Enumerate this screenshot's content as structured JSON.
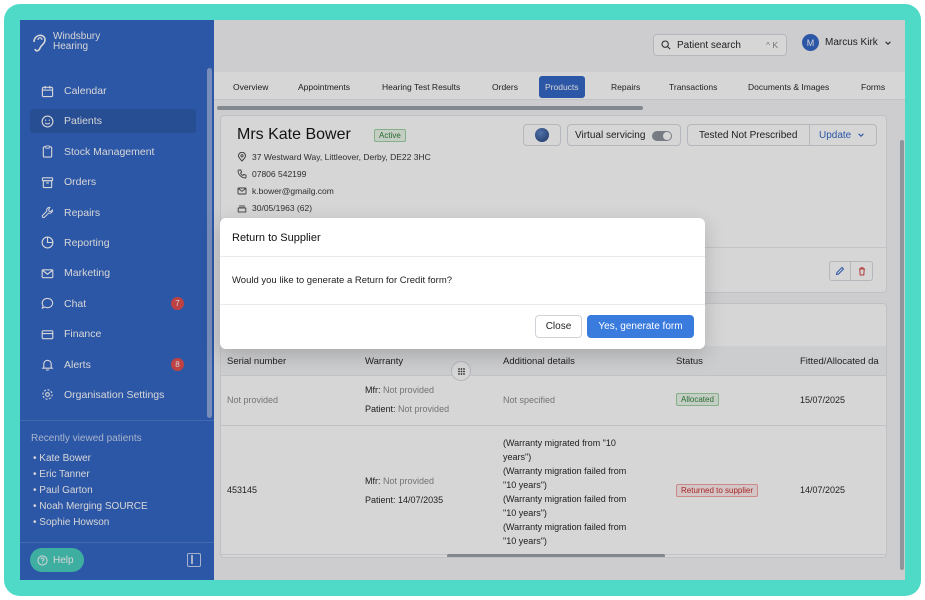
{
  "brand": {
    "line1": "Windsbury",
    "line2": "Hearing"
  },
  "sidebar": {
    "items": [
      {
        "label": "Calendar",
        "icon": "calendar-icon"
      },
      {
        "label": "Patients",
        "icon": "smile-icon",
        "active": true
      },
      {
        "label": "Stock Management",
        "icon": "clipboard-icon"
      },
      {
        "label": "Orders",
        "icon": "box-icon"
      },
      {
        "label": "Repairs",
        "icon": "wrench-icon"
      },
      {
        "label": "Reporting",
        "icon": "pie-chart-icon"
      },
      {
        "label": "Marketing",
        "icon": "mail-icon"
      },
      {
        "label": "Chat",
        "icon": "chat-icon",
        "badge": "7"
      },
      {
        "label": "Finance",
        "icon": "card-icon"
      },
      {
        "label": "Alerts",
        "icon": "bell-icon",
        "badge": "8"
      },
      {
        "label": "Organisation Settings",
        "icon": "gear-icon"
      }
    ],
    "recent_title": "Recently viewed patients",
    "recent": [
      "Kate Bower",
      "Eric Tanner",
      "Paul Garton",
      "Noah Merging SOURCE",
      "Sophie Howson"
    ],
    "help_label": "Help"
  },
  "topbar": {
    "search_label": "Patient search",
    "shortcut": "^ K",
    "user_initial": "M",
    "user_name": "Marcus Kirk"
  },
  "tabs": [
    "Overview",
    "Appointments",
    "Hearing Test Results",
    "Orders",
    "Products",
    "Repairs",
    "Transactions",
    "Documents & Images",
    "Forms"
  ],
  "active_tab": "Products",
  "patient": {
    "name": "Mrs Kate Bower",
    "status": "Active",
    "address": "37 Westward Way, Littleover, Derby, DE22 3HC",
    "phone": "07806 542199",
    "email": "k.bower@gmailg.com",
    "dob": "30/05/1963 (62)",
    "virtual_servicing_label": "Virtual servicing",
    "hearing_status": "Tested Not Prescribed",
    "update_label": "Update"
  },
  "table": {
    "headers": [
      "Serial number",
      "Warranty",
      "Additional details",
      "Status",
      "Fitted/Allocated da"
    ],
    "mfr_label": "Mfr:",
    "patient_label": "Patient:",
    "rows": [
      {
        "serial": "Not provided",
        "mfr": "Not provided",
        "patient_warranty": "Not provided",
        "details": [
          "Not specified"
        ],
        "status": "Allocated",
        "date": "15/07/2025"
      },
      {
        "serial": "453145",
        "mfr": "Not provided",
        "patient_warranty": "14/07/2035",
        "details": [
          "(Warranty migrated from \"10",
          "years\")",
          "(Warranty migration failed from",
          "\"10 years\")",
          "(Warranty migration failed from",
          "\"10 years\")",
          "(Warranty migration failed from",
          "\"10 years\")"
        ],
        "status": "Returned to supplier",
        "date": "14/07/2025"
      }
    ]
  },
  "modal": {
    "title": "Return to Supplier",
    "body": "Would you like to generate a Return for Credit form?",
    "close_label": "Close",
    "confirm_label": "Yes, generate form"
  },
  "colors": {
    "frame": "#4fd9c7",
    "sidebar": "#3064c4",
    "primary": "#3a7bde",
    "badge": "#e24b4b"
  }
}
